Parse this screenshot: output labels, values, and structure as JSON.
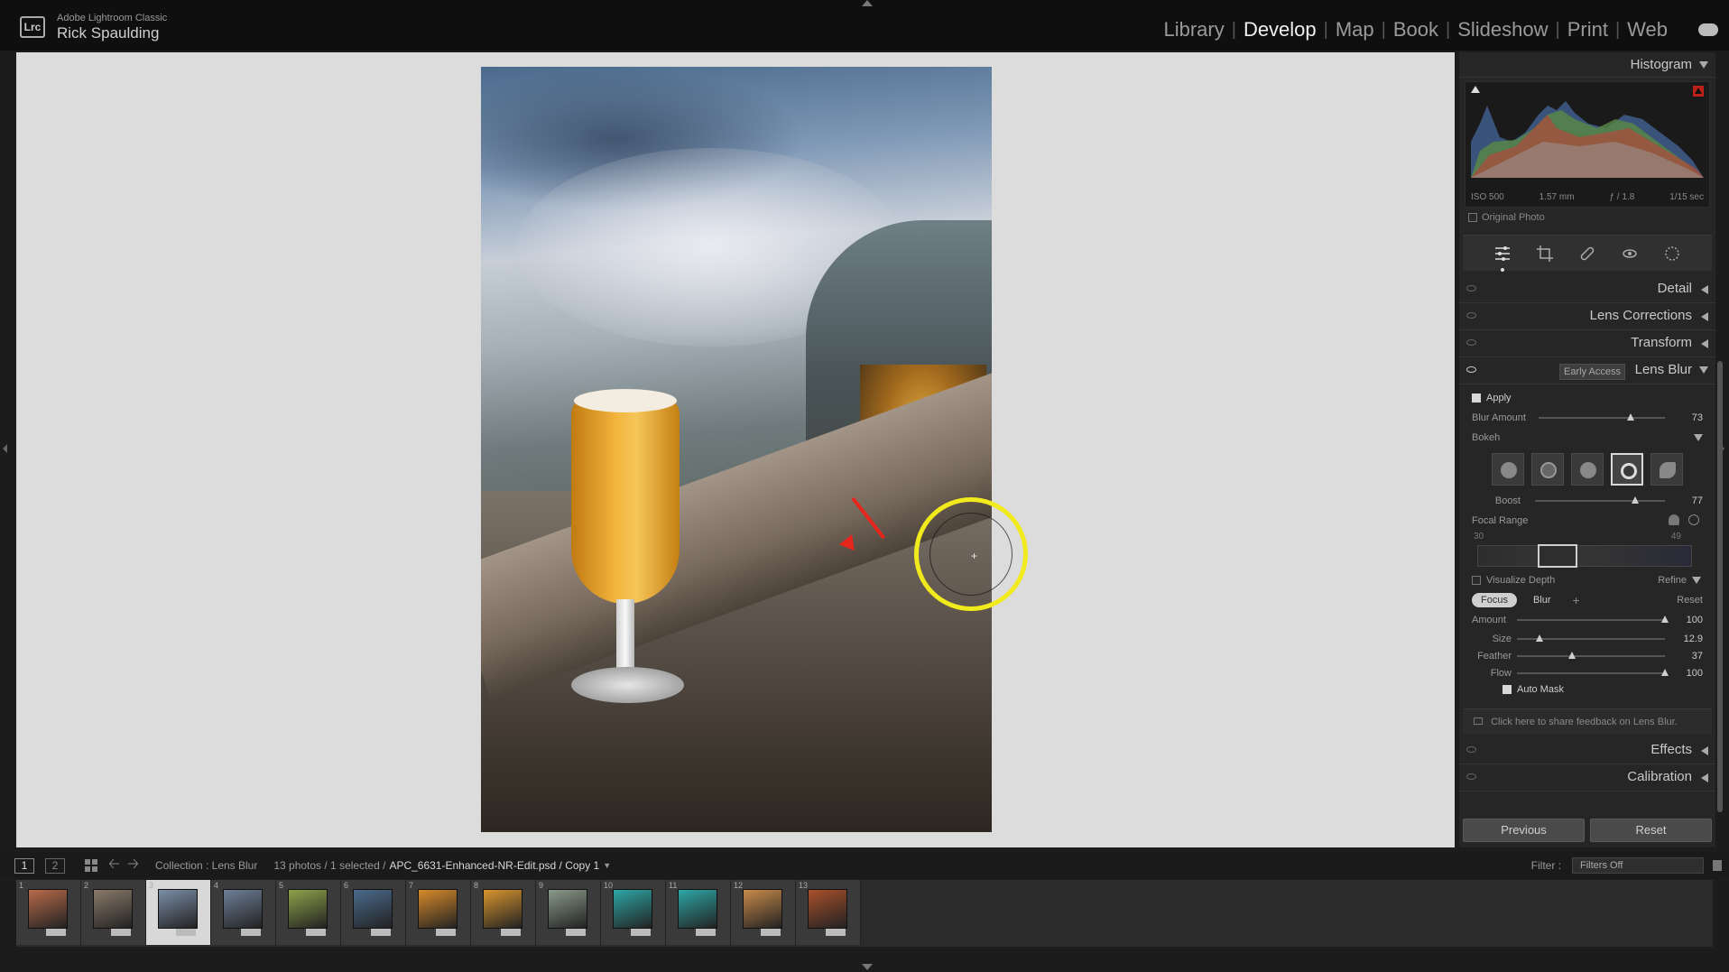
{
  "topbar": {
    "logo_text": "Lrc",
    "app_name": "Adobe Lightroom Classic",
    "user_name": "Rick Spaulding",
    "modules": [
      "Library",
      "Develop",
      "Map",
      "Book",
      "Slideshow",
      "Print",
      "Web"
    ],
    "active_module": "Develop"
  },
  "histogram": {
    "title": "Histogram",
    "iso": "ISO 500",
    "focal": "1.57 mm",
    "aperture": "ƒ / 1.8",
    "shutter": "1/15 sec",
    "original_photo": "Original Photo"
  },
  "panels": {
    "detail": "Detail",
    "lens_corrections": "Lens Corrections",
    "transform": "Transform",
    "lens_blur": "Lens Blur",
    "early_access": "Early Access",
    "effects": "Effects",
    "calibration": "Calibration"
  },
  "lens_blur": {
    "apply": "Apply",
    "blur_amount_label": "Blur Amount",
    "blur_amount": "73",
    "bokeh_label": "Bokeh",
    "boost_label": "Boost",
    "boost": "77",
    "focal_range_label": "Focal Range",
    "focal_min": "30",
    "focal_max": "49",
    "visualize_depth": "Visualize Depth",
    "refine": "Refine",
    "focus_chip": "Focus",
    "blur_chip": "Blur",
    "plus": "+",
    "reset_link": "Reset",
    "amount_label": "Amount",
    "amount": "100",
    "size_label": "Size",
    "size": "12.9",
    "feather_label": "Feather",
    "feather": "37",
    "flow_label": "Flow",
    "flow": "100",
    "auto_mask": "Auto Mask",
    "feedback": "Click here to share feedback on Lens Blur."
  },
  "slider_levels": {
    "blur_amount": 0.73,
    "boost": 0.77,
    "amount": 1.0,
    "size": 0.155,
    "feather": 0.37,
    "flow": 1.0
  },
  "buttons": {
    "previous": "Previous",
    "reset": "Reset"
  },
  "filmbar": {
    "view1": "1",
    "view2": "2",
    "collection": "Collection : Lens Blur",
    "count": "13 photos / 1 selected /",
    "filename": "APC_6631-Enhanced-NR-Edit.psd / Copy 1",
    "filter_label": "Filter :",
    "filter_value": "Filters Off"
  },
  "filmstrip": {
    "thumbs": [
      {
        "num": "1",
        "color": "#b86a4a"
      },
      {
        "num": "2",
        "color": "#8a7a6a"
      },
      {
        "num": "3",
        "color": "#7b8ea8"
      },
      {
        "num": "4",
        "color": "#6e7f98"
      },
      {
        "num": "5",
        "color": "#8fa24a"
      },
      {
        "num": "6",
        "color": "#4a6a8c"
      },
      {
        "num": "7",
        "color": "#d88a2a"
      },
      {
        "num": "8",
        "color": "#d8952e"
      },
      {
        "num": "9",
        "color": "#8a9a8a"
      },
      {
        "num": "10",
        "color": "#2ea6a6"
      },
      {
        "num": "11",
        "color": "#2ea6a6"
      },
      {
        "num": "12",
        "color": "#c88a4a"
      },
      {
        "num": "13",
        "color": "#a8502a"
      }
    ],
    "selected_index": 2
  }
}
